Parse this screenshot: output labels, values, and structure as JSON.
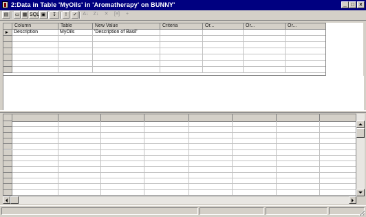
{
  "window": {
    "title": "2:Data in Table 'MyOils' in 'Aromatherapy' on BUNNY'",
    "buttons": {
      "minimize": "_",
      "maximize": "□",
      "close": "×"
    }
  },
  "toolbar": {
    "items": [
      {
        "name": "properties-button",
        "label": "▤",
        "enabled": true
      },
      {
        "name": "diagram-pane-button",
        "label": "▭",
        "enabled": true
      },
      {
        "name": "grid-pane-button",
        "label": "▦",
        "enabled": true
      },
      {
        "name": "sql-pane-button",
        "label": "SQL",
        "enabled": true
      },
      {
        "name": "results-pane-button",
        "label": "▣",
        "enabled": true
      },
      {
        "name": "change-query-type-button",
        "label": "↧",
        "enabled": true
      },
      {
        "name": "run-button",
        "label": "!",
        "enabled": true
      },
      {
        "name": "verify-sql-button",
        "label": "✓",
        "enabled": true
      },
      {
        "name": "sort-ascending-button",
        "label": "A↓",
        "enabled": false
      },
      {
        "name": "sort-descending-button",
        "label": "Z↓",
        "enabled": false
      },
      {
        "name": "remove-filter-button",
        "label": "✕",
        "enabled": false
      },
      {
        "name": "group-by-button",
        "label": "[≡]",
        "enabled": false
      },
      {
        "name": "add-table-button",
        "label": "+",
        "enabled": false
      }
    ]
  },
  "criteria_grid": {
    "columns": [
      "Column",
      "Table",
      "New Value",
      "Criteria",
      "Or...",
      "Or...",
      "Or..."
    ],
    "rows": [
      [
        "Description",
        "MyOils",
        "'Description of Basil'",
        "",
        "",
        "",
        ""
      ]
    ],
    "empty_rows": 6
  },
  "results_grid": {
    "columns": [
      "",
      "",
      "",
      "",
      "",
      "",
      "",
      ""
    ],
    "empty_rows": 13
  },
  "statusbar": {
    "panes": [
      "",
      "",
      "",
      ""
    ]
  }
}
